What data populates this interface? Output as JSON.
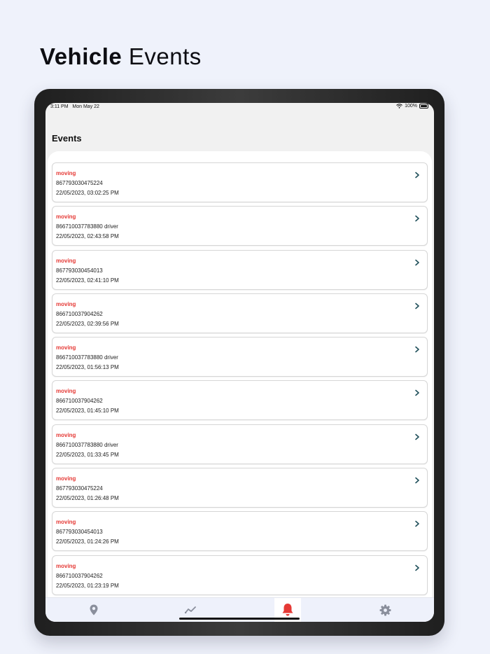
{
  "headline": {
    "bold": "Vehicle",
    "light": "Events"
  },
  "status_bar": {
    "time": "3:11 PM",
    "date": "Mon May 22",
    "battery": "100%"
  },
  "page_title": "Events",
  "events": [
    {
      "status": "moving",
      "device": "867793030475224",
      "time": "22/05/2023, 03:02:25 PM"
    },
    {
      "status": "moving",
      "device": "866710037783880 driver",
      "time": "22/05/2023, 02:43:58 PM"
    },
    {
      "status": "moving",
      "device": "867793030454013",
      "time": "22/05/2023, 02:41:10 PM"
    },
    {
      "status": "moving",
      "device": "866710037904262",
      "time": "22/05/2023, 02:39:56 PM"
    },
    {
      "status": "moving",
      "device": "866710037783880 driver",
      "time": "22/05/2023, 01:56:13 PM"
    },
    {
      "status": "moving",
      "device": "866710037904262",
      "time": "22/05/2023, 01:45:10 PM"
    },
    {
      "status": "moving",
      "device": "866710037783880 driver",
      "time": "22/05/2023, 01:33:45 PM"
    },
    {
      "status": "moving",
      "device": "867793030475224",
      "time": "22/05/2023, 01:26:48 PM"
    },
    {
      "status": "moving",
      "device": "867793030454013",
      "time": "22/05/2023, 01:24:26 PM"
    },
    {
      "status": "moving",
      "device": "866710037904262",
      "time": "22/05/2023, 01:23:19 PM"
    }
  ],
  "tabs": [
    {
      "icon": "map-pin-icon",
      "active": false
    },
    {
      "icon": "trend-line-icon",
      "active": false
    },
    {
      "icon": "bell-icon",
      "active": true
    },
    {
      "icon": "gear-icon",
      "active": false
    }
  ],
  "colors": {
    "status_moving": "#e53935",
    "chevron": "#1f4f5a",
    "tab_inactive": "#8a8f9c",
    "tab_active": "#e53935",
    "background": "#eff2fb"
  }
}
